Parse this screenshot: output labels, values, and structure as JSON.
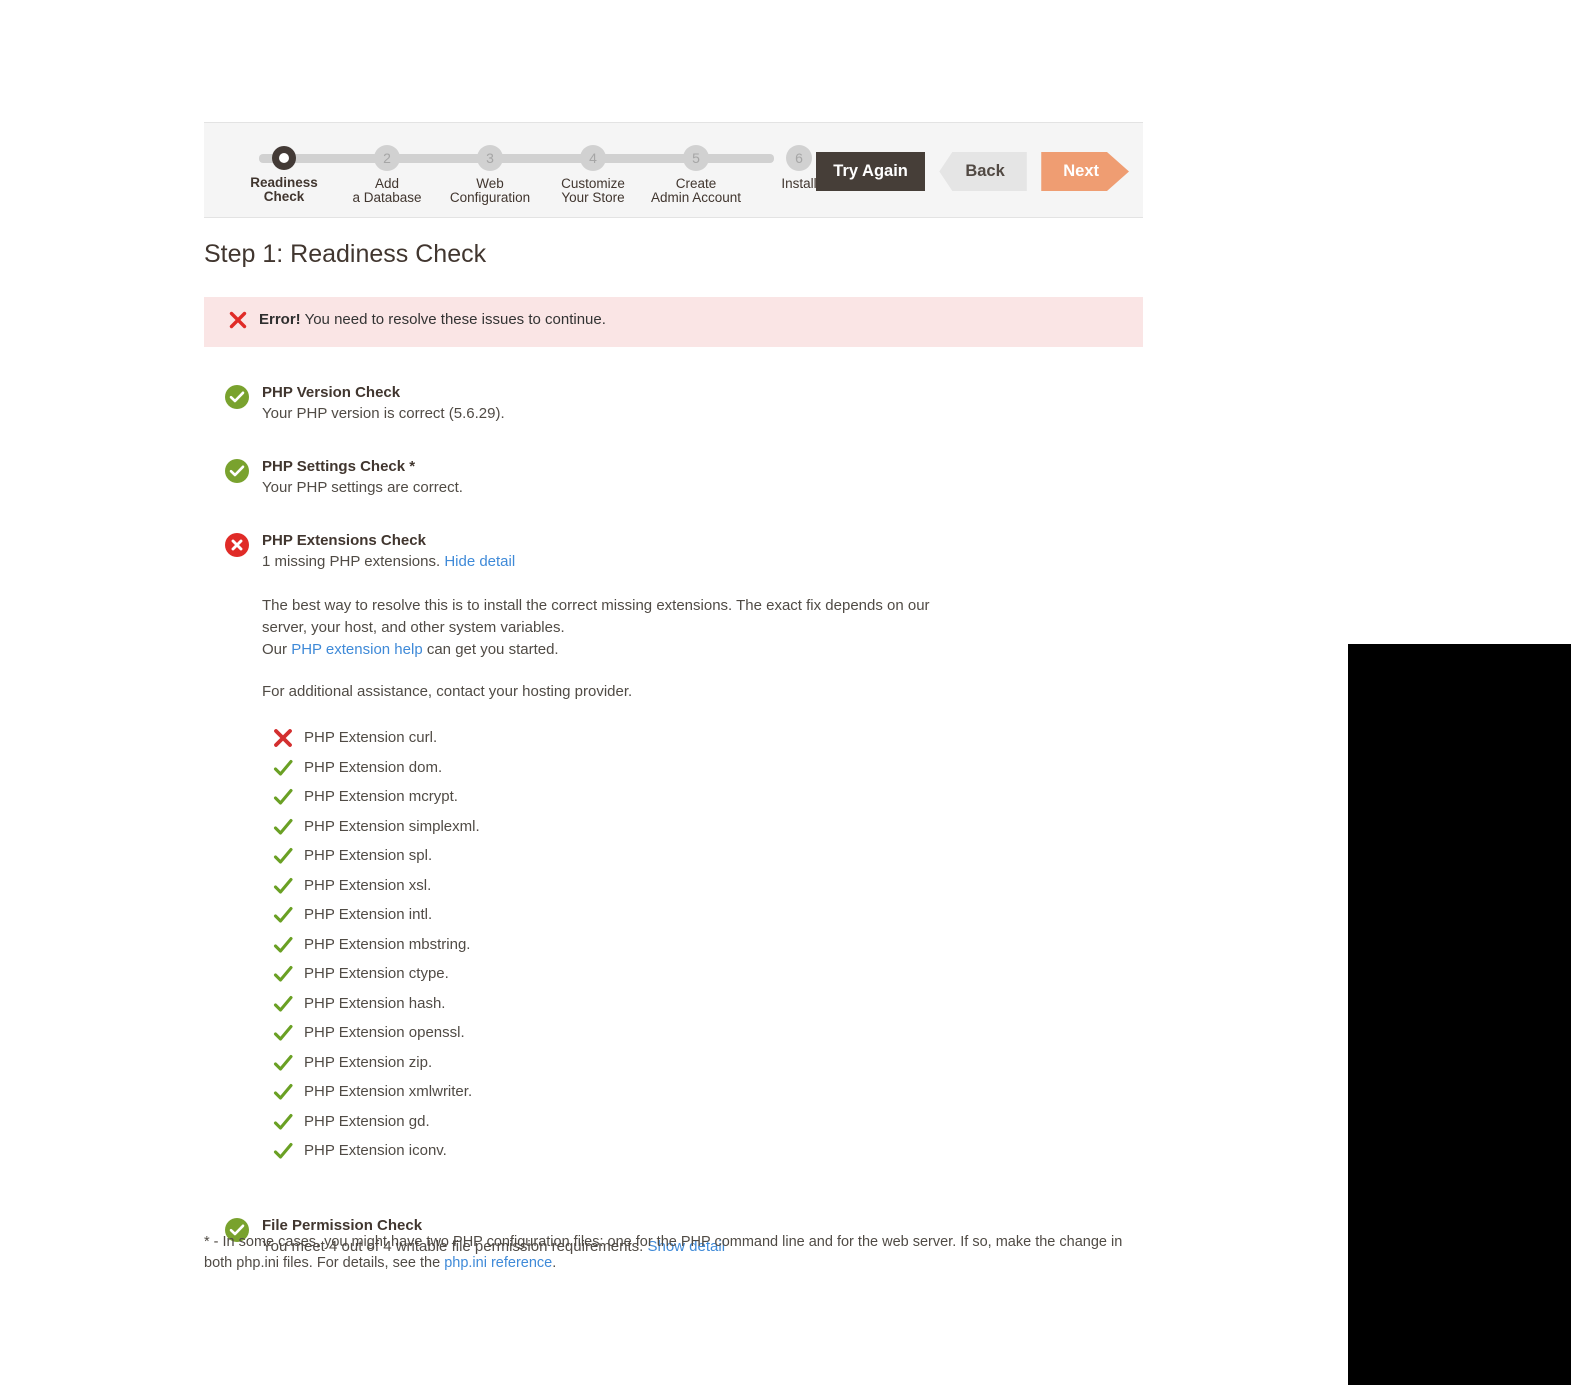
{
  "wizard": {
    "steps": [
      {
        "number": "1",
        "label_lines": [
          "Readiness",
          "Check"
        ],
        "state": "active"
      },
      {
        "number": "2",
        "label_lines": [
          "Add",
          "a Database"
        ],
        "state": "pending"
      },
      {
        "number": "3",
        "label_lines": [
          "Web",
          "Configuration"
        ],
        "state": "pending"
      },
      {
        "number": "4",
        "label_lines": [
          "Customize",
          "Your Store"
        ],
        "state": "pending"
      },
      {
        "number": "5",
        "label_lines": [
          "Create",
          "Admin Account"
        ],
        "state": "pending"
      },
      {
        "number": "6",
        "label_lines": [
          "Install"
        ],
        "state": "pending"
      }
    ],
    "buttons": {
      "try_again": "Try Again",
      "back": "Back",
      "next": "Next"
    }
  },
  "page": {
    "title": "Step 1: Readiness Check"
  },
  "alert": {
    "icon": "error-x-icon",
    "strong": "Error!",
    "text": " You need to resolve these issues to continue."
  },
  "checks": [
    {
      "id": "php-version-check",
      "status": "ok",
      "title": "PHP Version Check",
      "desc": "Your PHP version is correct (5.6.29)."
    },
    {
      "id": "php-settings-check",
      "status": "ok",
      "title": "PHP Settings Check *",
      "desc": "Your PHP settings are correct."
    },
    {
      "id": "php-extensions-check",
      "status": "fail",
      "title": "PHP Extensions Check",
      "desc": "1 missing PHP extensions.",
      "toggle_link": "Hide detail"
    },
    {
      "id": "file-permission-check",
      "status": "ok",
      "title": "File Permission Check",
      "desc": "You meet 4 out of 4 writable file permission requirements.",
      "toggle_link": "Show detail"
    }
  ],
  "extension_detail": {
    "paragraph_1": "The best way to resolve this is to install the correct missing extensions. The exact fix depends on our server, your host, and other system variables.",
    "paragraph_2_prefix": "Our ",
    "paragraph_2_link": "PHP extension help",
    "paragraph_2_suffix": " can get you started.",
    "paragraph_3": "For additional assistance, contact your hosting provider.",
    "items": [
      {
        "label": "PHP Extension curl.",
        "status": "fail"
      },
      {
        "label": "PHP Extension dom.",
        "status": "ok"
      },
      {
        "label": "PHP Extension mcrypt.",
        "status": "ok"
      },
      {
        "label": "PHP Extension simplexml.",
        "status": "ok"
      },
      {
        "label": "PHP Extension spl.",
        "status": "ok"
      },
      {
        "label": "PHP Extension xsl.",
        "status": "ok"
      },
      {
        "label": "PHP Extension intl.",
        "status": "ok"
      },
      {
        "label": "PHP Extension mbstring.",
        "status": "ok"
      },
      {
        "label": "PHP Extension ctype.",
        "status": "ok"
      },
      {
        "label": "PHP Extension hash.",
        "status": "ok"
      },
      {
        "label": "PHP Extension openssl.",
        "status": "ok"
      },
      {
        "label": "PHP Extension zip.",
        "status": "ok"
      },
      {
        "label": "PHP Extension xmlwriter.",
        "status": "ok"
      },
      {
        "label": "PHP Extension gd.",
        "status": "ok"
      },
      {
        "label": "PHP Extension iconv.",
        "status": "ok"
      }
    ]
  },
  "footnote": {
    "text_before": "* - In some cases, you might have two PHP configuration files: one for the PHP command line and for the web server. If so, make the change in both php.ini files. For details, see the ",
    "link": "php.ini reference",
    "text_after": "."
  },
  "colors": {
    "accent_orange": "#ef9d72",
    "dark_brown": "#463e38",
    "success_green": "#79a22e",
    "error_red": "#e02b27",
    "link_blue": "#3f8ad8",
    "alert_bg": "#fae5e5",
    "panel_bg": "#f5f5f5"
  }
}
